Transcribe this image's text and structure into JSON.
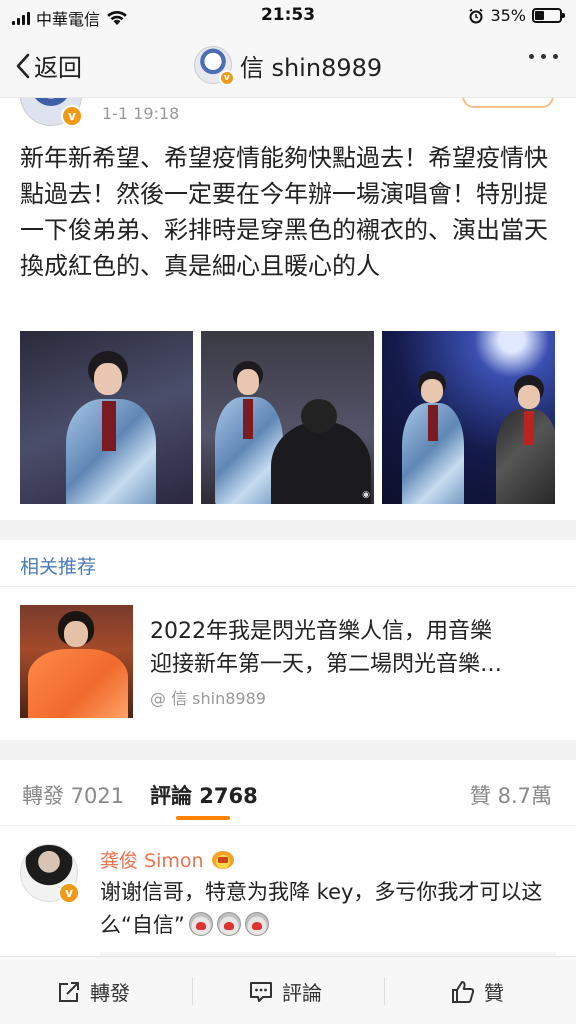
{
  "status_bar": {
    "carrier": "中華電信",
    "time": "21:53",
    "battery": "35%"
  },
  "nav": {
    "back_label": "返回",
    "title": "信 shin8989"
  },
  "post": {
    "time": "1-1 19:18",
    "text": "新年新希望、希望疫情能夠快點過去！希望疫情快點過去！然後一定要在今年辦一場演唱會！特別提一下俊弟弟、彩排時是穿黑色的襯衣的、演出當天換成紅色的、真是細心且暖心的人"
  },
  "recommend": {
    "heading": "相关推荐",
    "line1": "2022年我是閃光音樂人信，用音樂",
    "line2": "迎接新年第一天，第二場閃光音樂…",
    "author": "@ 信 shin8989"
  },
  "tabs": {
    "repost": "轉發 7021",
    "comment": "評論 2768",
    "like": "贊 8.7萬"
  },
  "comment": {
    "name": "龚俊 Simon",
    "text": "谢谢信哥，特意为我降 key，多亏你我才可以这么“自信”"
  },
  "toolbar": {
    "repost": "轉發",
    "comment": "評論",
    "like": "贊"
  },
  "colors": {
    "accent": "#ff8200",
    "link": "#4a7bb7",
    "username": "#eb7350"
  }
}
